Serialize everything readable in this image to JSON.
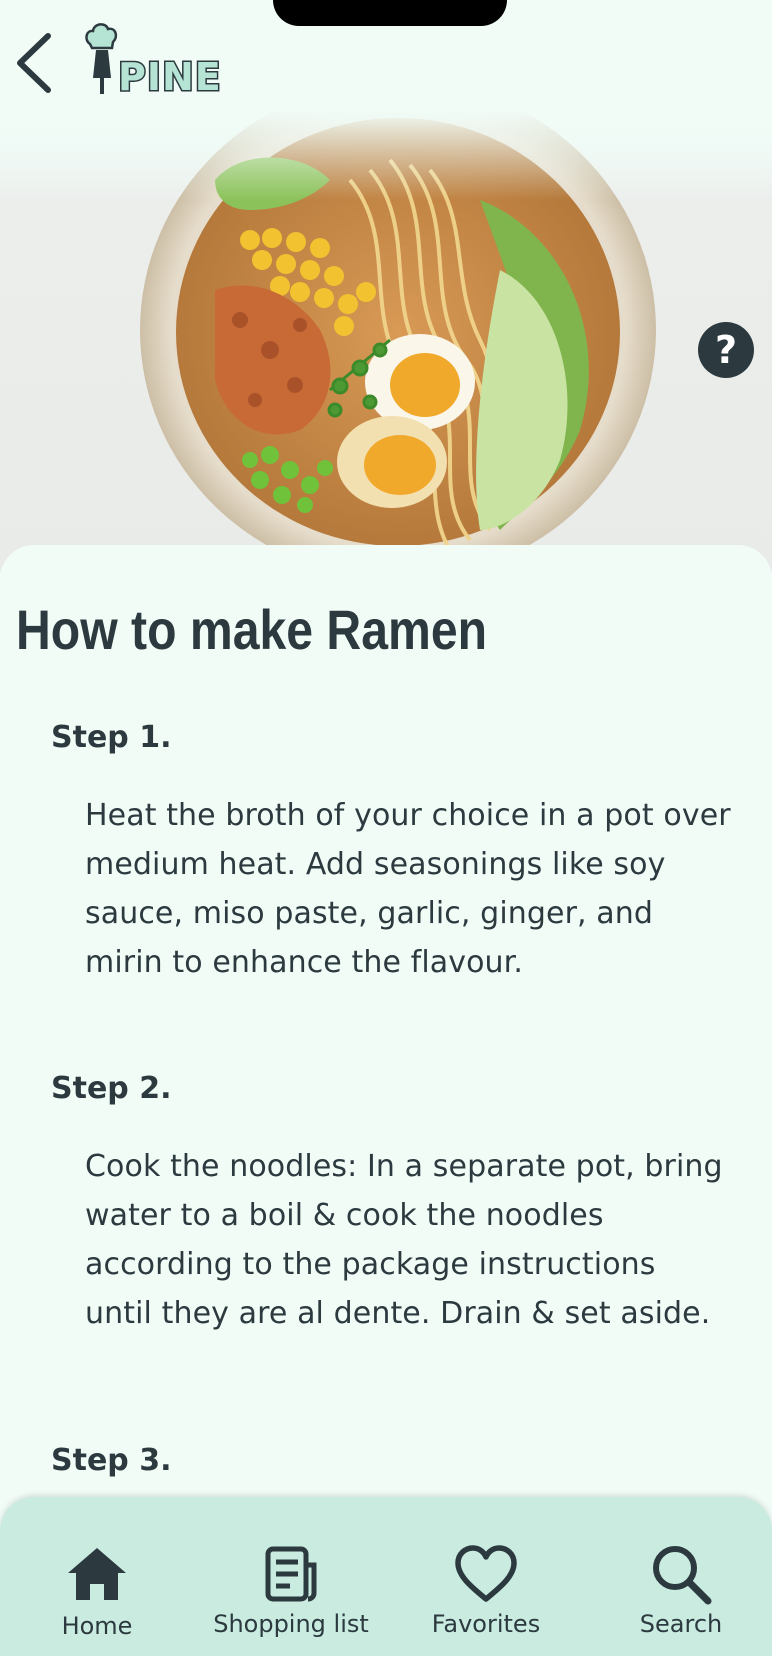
{
  "header": {
    "back_icon": "chevron-left-icon",
    "logo_text": "PINE"
  },
  "hero": {
    "image_description": "ramen bowl photo",
    "help_label": "?"
  },
  "recipe": {
    "title": "How to make Ramen",
    "steps": [
      {
        "label": "Step 1.",
        "lines": [
          "Heat the broth of your choice in a pot over",
          "medium heat. Add seasonings like soy",
          "sauce, miso paste, garlic, ginger, and",
          "mirin to enhance the flavour."
        ]
      },
      {
        "label": "Step 2.",
        "lines": [
          "Cook the noodles: In a separate pot, bring",
          "water to a boil & cook the noodles",
          "according to the package instructions",
          "until they are al dente. Drain & set aside."
        ]
      },
      {
        "label": "Step 3.",
        "lines": []
      }
    ]
  },
  "nav": {
    "items": [
      {
        "label": "Home",
        "icon": "home-icon"
      },
      {
        "label": "Shopping list",
        "icon": "shopping-list-icon"
      },
      {
        "label": "Favorites",
        "icon": "heart-icon"
      },
      {
        "label": "Search",
        "icon": "search-icon"
      }
    ]
  },
  "colors": {
    "background": "#f1fcf7",
    "text": "#2c3a3f",
    "nav_background": "#c9ebe0",
    "logo_fill": "#b5e3d4"
  }
}
